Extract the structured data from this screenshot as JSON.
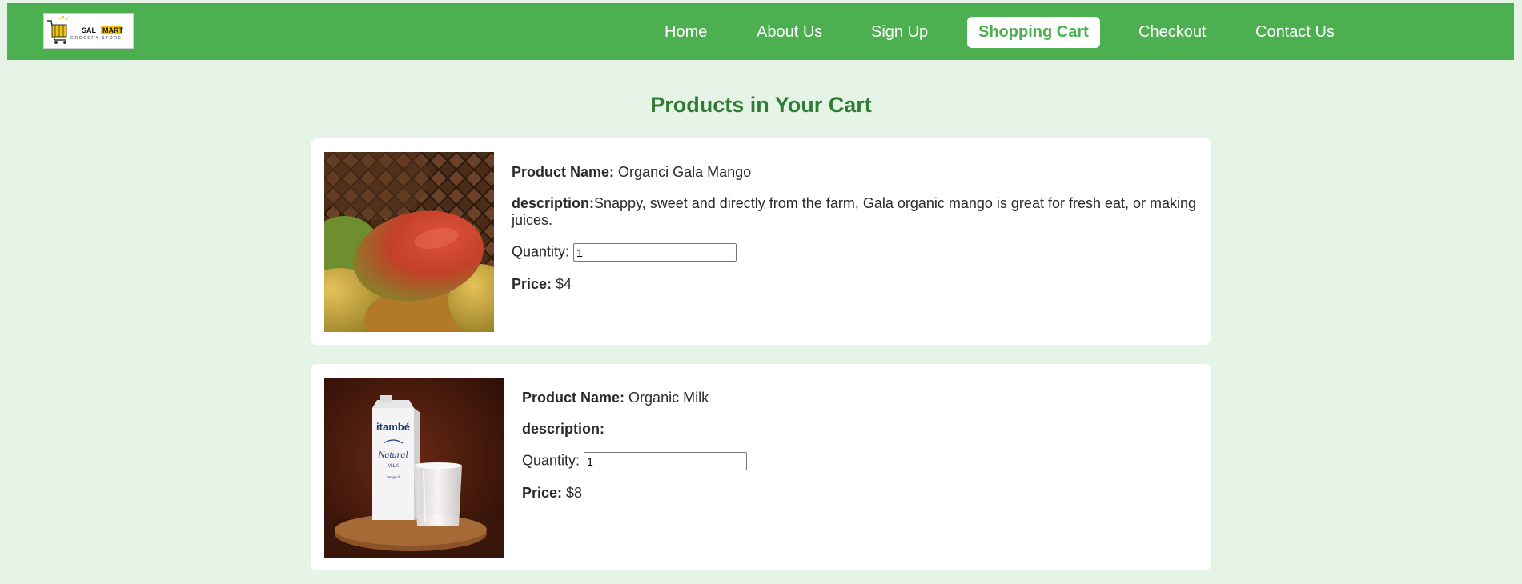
{
  "header": {
    "logo": {
      "word1": "SAL",
      "word2": "MART",
      "tagline": "GROCERY STORE"
    },
    "nav": [
      {
        "label": "Home"
      },
      {
        "label": "About Us"
      },
      {
        "label": "Sign Up"
      },
      {
        "label": "Shopping Cart",
        "active": true
      },
      {
        "label": "Checkout"
      },
      {
        "label": "Contact Us"
      }
    ]
  },
  "page": {
    "title": "Products in Your Cart"
  },
  "cart": {
    "labels": {
      "name": "Product Name:",
      "description": "description:",
      "quantity": "Quantity:",
      "price": "Price:"
    },
    "items": [
      {
        "name": "Organci Gala Mango",
        "description": "Snappy, sweet and directly from the farm, Gala organic mango is great for fresh eat, or making juices.",
        "quantity": "1",
        "price": "$4",
        "image": "mango-photo"
      },
      {
        "name": "Organic Milk",
        "description": "",
        "quantity": "1",
        "price": "$8",
        "image": "milk-carton-photo",
        "image_text": {
          "brand": "itambé",
          "line1": "Natural",
          "line2": "MILK",
          "line3": "Integral"
        }
      }
    ]
  },
  "colors": {
    "nav_bg": "#4caf50",
    "page_bg": "#e6f4e7",
    "title": "#2e7d32",
    "card_bg": "#ffffff"
  }
}
